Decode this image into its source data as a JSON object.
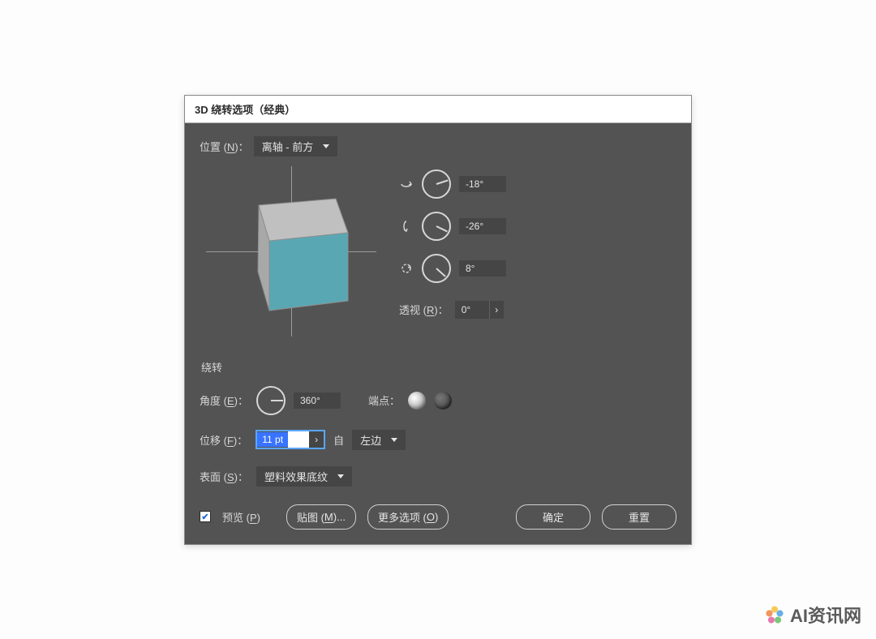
{
  "title": "3D 绕转选项（经典）",
  "position": {
    "label_pre": "位置 (",
    "label_key": "N",
    "label_post": ")：",
    "value": "离轴 - 前方"
  },
  "rotation": {
    "x_value": "-18°",
    "y_value": "-26°",
    "z_value": "8°",
    "x_angle_deg": -18,
    "y_angle_deg": 26,
    "z_angle_deg": 42
  },
  "perspective": {
    "label_pre": "透视 (",
    "label_key": "R",
    "label_post": ")：",
    "value": "0°"
  },
  "revolve": {
    "section": "绕转",
    "angle_label_pre": "角度 (",
    "angle_label_key": "E",
    "angle_label_post": ")：",
    "angle_value": "360°",
    "cap_label": "端点：",
    "offset_label_pre": "位移 (",
    "offset_label_key": "F",
    "offset_label_post": ")：",
    "offset_value": "11 pt",
    "from_label": "自",
    "from_value": "左边"
  },
  "surface": {
    "label_pre": "表面 (",
    "label_key": "S",
    "label_post": ")：",
    "value": "塑料效果底纹"
  },
  "footer": {
    "preview_label_pre": "预览 (",
    "preview_label_key": "P",
    "preview_label_post": ")",
    "map_art_pre": "贴图 (",
    "map_art_key": "M",
    "map_art_post": ")...",
    "more_pre": "更多选项 (",
    "more_key": "O",
    "more_post": ")",
    "ok": "确定",
    "reset": "重置"
  },
  "watermark": "AI资讯网"
}
